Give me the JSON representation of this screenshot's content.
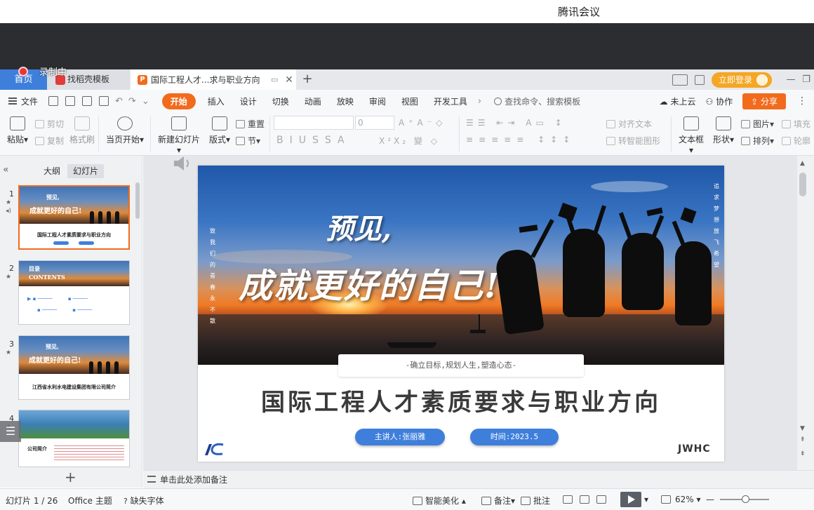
{
  "meeting": {
    "title": "腾讯会议",
    "recording_label": "录制中"
  },
  "tabs": {
    "home": "首页",
    "template": "找稻壳模板",
    "document": "国际工程人才...求与职业方向",
    "login": "立即登录"
  },
  "menu": {
    "file": "文件",
    "items": [
      "开始",
      "插入",
      "设计",
      "切换",
      "动画",
      "放映",
      "审阅",
      "视图",
      "开发工具"
    ],
    "search": "查找命令、搜索模板",
    "cloud": "未上云",
    "collab": "协作",
    "share": "分享"
  },
  "ribbon": {
    "paste": "粘贴",
    "cut": "剪切",
    "copy": "复制",
    "format_painter": "格式刷",
    "from_current": "当页开始",
    "new_slide": "新建幻灯片",
    "layout": "版式",
    "reset": "重置",
    "section": "节",
    "font_size": "0",
    "align_text": "对齐文本",
    "smart_art": "转智能图形",
    "text_box": "文本框",
    "shape": "形状",
    "picture": "图片",
    "arrange": "排列",
    "fill": "填充",
    "outline": "轮廓"
  },
  "leftpanel": {
    "outline_tab": "大纲",
    "slides_tab": "幻灯片",
    "thumbs": [
      {
        "num": "1",
        "line1": "预见,",
        "line2": "成就更好的自己!",
        "title": "国际工程人才素质要求与职业方向"
      },
      {
        "num": "2",
        "line1": "目录",
        "line2": "CONTENTS"
      },
      {
        "num": "3",
        "line1": "预见,",
        "line2": "成就更好的自己!",
        "title": "江西省水利水电建设集团有限公司简介"
      },
      {
        "num": "4",
        "title": "公司简介"
      }
    ]
  },
  "slide": {
    "title1": "预见,",
    "title2": "成就更好的自己!",
    "vertical_left": [
      "致",
      "我",
      "们",
      "的",
      "青",
      "春",
      "永",
      "不",
      "散"
    ],
    "vertical_right": [
      "追",
      "求",
      "梦",
      "想",
      "放",
      "飞",
      "希",
      "望"
    ],
    "subtitle": "-确立目标,规划人生,塑造心态-",
    "main_title": "国际工程人才素质要求与职业方向",
    "presenter": "主讲人:张丽雅",
    "date": "时间:2023.5",
    "logo_right": "JWHC"
  },
  "notes_placeholder": "单击此处添加备注",
  "status": {
    "slide_pos": "幻灯片 1 / 26",
    "theme": "Office 主题",
    "missing_font": "缺失字体",
    "beautify": "智能美化",
    "notes": "备注",
    "comment": "批注",
    "zoom": "62%"
  },
  "colors": {
    "accent": "#f26b1d",
    "blue": "#3f7fdc"
  }
}
